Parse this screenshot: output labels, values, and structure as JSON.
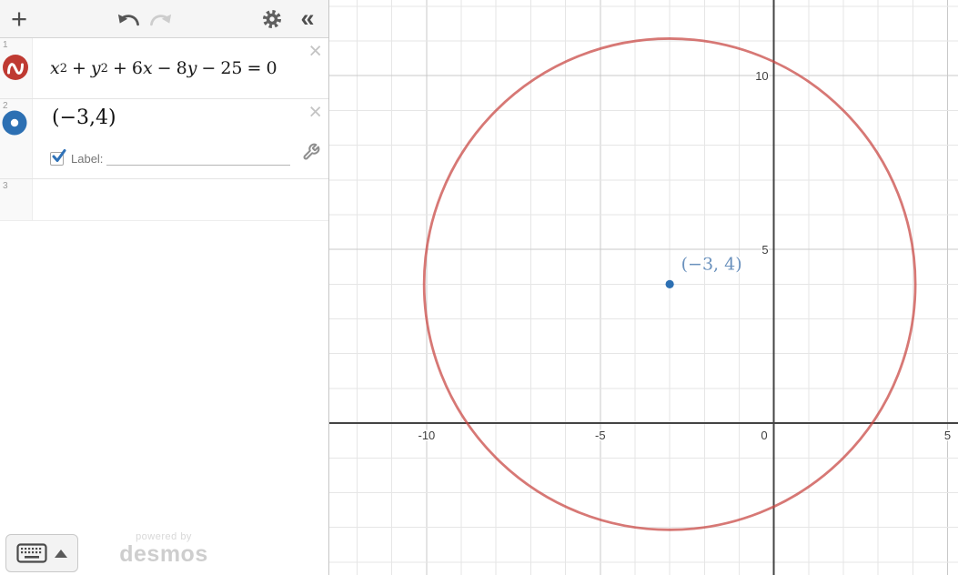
{
  "app": {
    "name": "Desmos graphing calculator"
  },
  "toolbar": {
    "add_label": "+",
    "undo_icon": "undo-arrow",
    "redo_icon": "redo-arrow",
    "settings_icon": "gear",
    "collapse_label": "«"
  },
  "expression_list": {
    "rows": [
      {
        "index": "1",
        "icon": "red-implicit-curve-logo",
        "close": "×",
        "equation_tokens": [
          {
            "t": "x",
            "s": "var"
          },
          {
            "t": "2",
            "s": "sup"
          },
          {
            "t": "+",
            "s": "op"
          },
          {
            "t": "y",
            "s": "var"
          },
          {
            "t": "2",
            "s": "sup"
          },
          {
            "t": "+",
            "s": "op"
          },
          {
            "t": "6",
            "s": "num"
          },
          {
            "t": "x",
            "s": "var"
          },
          {
            "t": "−",
            "s": "op"
          },
          {
            "t": "8",
            "s": "num"
          },
          {
            "t": "y",
            "s": "var"
          },
          {
            "t": "−",
            "s": "op"
          },
          {
            "t": "25",
            "s": "num"
          },
          {
            "t": "=",
            "s": "op"
          },
          {
            "t": "0",
            "s": "num"
          }
        ]
      },
      {
        "index": "2",
        "icon": "blue-point",
        "close": "×",
        "value": "(−3,4)",
        "label_checkbox": {
          "checked": true,
          "text": "Label:",
          "input_value": ""
        },
        "options_icon": "wrench"
      },
      {
        "index": "3"
      }
    ]
  },
  "footer": {
    "keyboard_icon": "keyboard",
    "expand_icon": "up-triangle",
    "watermark_small": "powered by",
    "watermark_brand": "desmos"
  },
  "colors": {
    "curve_red": "#c74440",
    "point_blue": "#2d70b3",
    "point_label_blue": "#6a91bd",
    "logo_red": "#bf3a32",
    "axis": "#444444",
    "grid_minor": "#e6e6e6",
    "grid_major": "#c9c9c9"
  },
  "chart_data": {
    "type": "implicit-equation-graph",
    "equations": [
      {
        "latex": "x^2 + y^2 + 6x − 8y − 25 = 0",
        "shape": "circle",
        "center": [
          -3,
          4
        ],
        "radius": 7.0711,
        "color": "#c74440"
      }
    ],
    "points": [
      {
        "x": -3,
        "y": 4,
        "label": "(−3, 4)",
        "color": "#2d70b3"
      }
    ],
    "xlim": [
      -12.8,
      5.3
    ],
    "ylim": [
      -4.37,
      12.18
    ],
    "x_tick_labels": [
      -10,
      -5,
      0,
      5
    ],
    "y_tick_labels": [
      5,
      10
    ],
    "grid_step": 1,
    "major_step": 5,
    "grid": true,
    "title": "",
    "xlabel": "",
    "ylabel": ""
  }
}
